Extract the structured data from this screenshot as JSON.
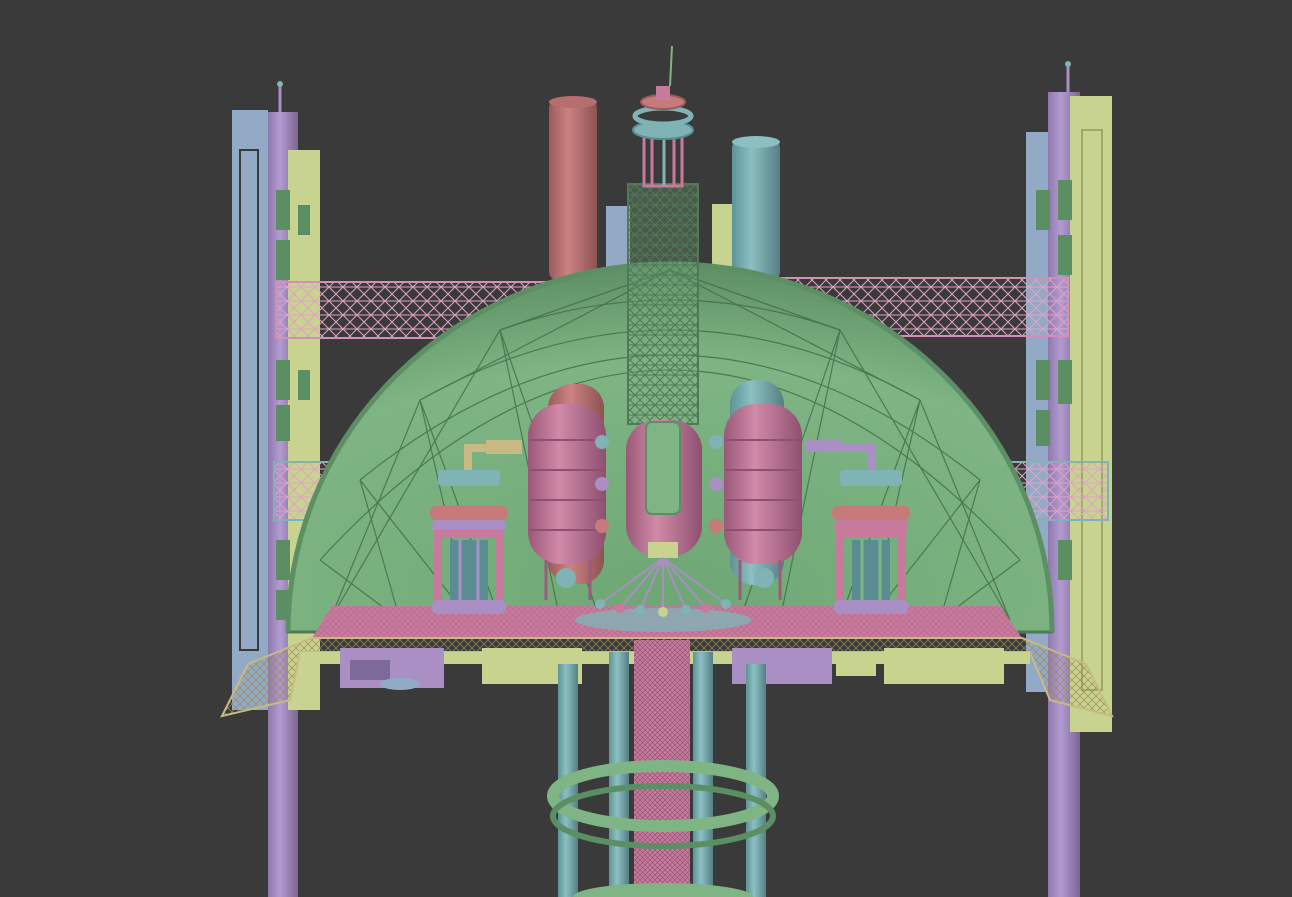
{
  "viewport": {
    "background": "#3a3a3a",
    "shading_mode": "solid-random-colors"
  },
  "palette": {
    "pink": "#c77a9c",
    "pink_dark": "#9c5a7c",
    "green": "#7fb584",
    "green_dark": "#5b8f63",
    "teal": "#7fb3b5",
    "teal_dark": "#5a8d92",
    "lavender": "#a98fc4",
    "lavender_dark": "#7e6a9a",
    "blue_gray": "#93aac6",
    "yellow_green": "#c8d38f",
    "yellow_green_dark": "#9ea86a",
    "salmon": "#c77a7a",
    "salmon_dark": "#9d5a5a",
    "lattice_pink": "#d48fb5",
    "tan": "#c9b982"
  },
  "scene": {
    "object": "sci-fi-reactor-dome-tower",
    "components": [
      "dome",
      "central-lattice-tower",
      "reactor-tanks",
      "cooling-towers",
      "side-pylons",
      "truss-bridges",
      "platform-deck",
      "support-legs",
      "support-ring"
    ]
  }
}
